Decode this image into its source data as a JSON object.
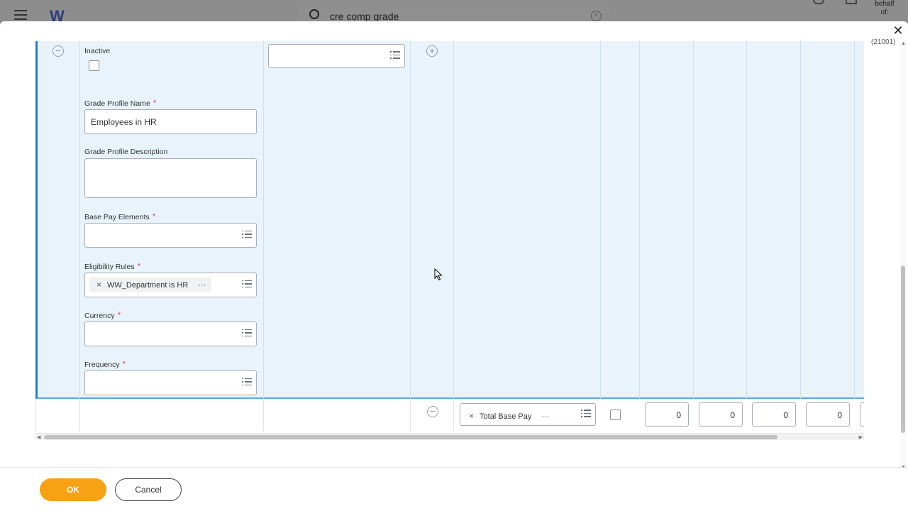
{
  "background": {
    "search_text": "cre comp grade",
    "on_behalf_line1": "behalf",
    "on_behalf_line2": "of:",
    "logo": "W"
  },
  "modal": {
    "badge_code": "(21001)",
    "close_icon": "close-icon"
  },
  "expanded_row": {
    "inactive_label": "Inactive",
    "inactive_checked": false,
    "grade_profile_name_label": "Grade Profile Name",
    "grade_profile_name_value": "Employees in HR",
    "grade_profile_description_label": "Grade Profile Description",
    "grade_profile_description_value": "",
    "base_pay_elements_label": "Base Pay Elements",
    "eligibility_rules_label": "Eligibility Rules",
    "eligibility_rules_selected": "WW_Department is HR",
    "currency_label": "Currency",
    "frequency_label": "Frequency",
    "required_marker": "*"
  },
  "bottom_row": {
    "pay_component": "Total Base Pay",
    "checkbox_checked": false,
    "amounts": [
      "0",
      "0",
      "0",
      "0"
    ]
  },
  "footer": {
    "ok_label": "OK",
    "cancel_label": "Cancel"
  },
  "colors": {
    "accent": "#f7a113",
    "row_highlight": "#e8f3fb",
    "row_border": "#1f7dd4",
    "required": "#d9534f"
  }
}
